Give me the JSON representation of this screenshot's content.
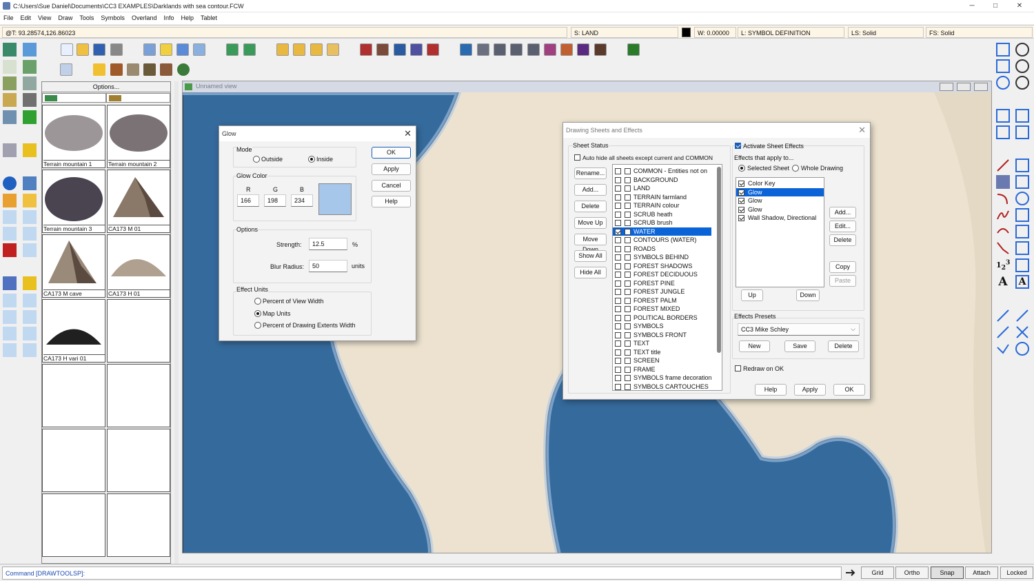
{
  "window": {
    "title": "C:\\Users\\Sue Daniel\\Documents\\CC3 EXAMPLES\\Darklands with sea contour.FCW",
    "min": "─",
    "max": "□",
    "close": "✕"
  },
  "menu": [
    "File",
    "Edit",
    "View",
    "Draw",
    "Tools",
    "Symbols",
    "Overland",
    "Info",
    "Help",
    "Tablet"
  ],
  "status": {
    "coords": "@T: 93.28574,126.86023",
    "sheet": "S: LAND",
    "width": "W: 0.00000",
    "layer": "L: SYMBOL DEFINITION",
    "line_style": "LS: Solid",
    "fill_style": "FS: Solid"
  },
  "symbols": {
    "options_label": "Options...",
    "items": [
      "Terrain mountain 1",
      "Terrain mountain 2",
      "Terrain mountain 3",
      "CA173 M 01",
      "CA173 M cave",
      "CA173 H 01",
      "CA173 H vari 01"
    ]
  },
  "map": {
    "title": "Unnamed view"
  },
  "glow": {
    "title": "Glow",
    "mode_label": "Mode",
    "outside": "Outside",
    "inside": "Inside",
    "color_label": "Glow Color",
    "r_label": "R",
    "g_label": "G",
    "b_label": "B",
    "r": "166",
    "g": "198",
    "b": "234",
    "swatch": "#a6c6ea",
    "options_label": "Options",
    "strength_label": "Strength:",
    "strength": "12.5",
    "strength_unit": "%",
    "blur_label": "Blur Radius:",
    "blur": "50",
    "blur_unit": "units",
    "units_label": "Effect Units",
    "u1": "Percent of View Width",
    "u2": "Map Units",
    "u3": "Percent of Drawing Extents Width",
    "ok": "OK",
    "apply": "Apply",
    "cancel": "Cancel",
    "help": "Help"
  },
  "sheets": {
    "title": "Drawing Sheets and Effects",
    "status_label": "Sheet Status",
    "auto_hide": "Auto hide all sheets except current and COMMON",
    "buttons": [
      "Rename...",
      "Add...",
      "Delete",
      "Move Up",
      "Move Down",
      "Show All",
      "Hide All"
    ],
    "list": [
      "COMMON - Entities not on",
      "BACKGROUND",
      "LAND",
      "TERRAIN farmland",
      "TERRAIN colour",
      "SCRUB heath",
      "SCRUB brush",
      "WATER",
      "CONTOURS (WATER)",
      "ROADS",
      "SYMBOLS BEHIND",
      "FOREST SHADOWS",
      "FOREST DECIDUOUS",
      "FOREST PINE",
      "FOREST JUNGLE",
      "FOREST PALM",
      "FOREST MIXED",
      "POLITICAL BORDERS",
      "SYMBOLS",
      "SYMBOLS FRONT",
      "TEXT",
      "TEXT title",
      "SCREEN",
      "FRAME",
      "SYMBOLS frame decoration",
      "SYMBOLS CARTOUCHES"
    ],
    "selected": "WATER",
    "activate": "Activate Sheet Effects",
    "applies_to": "Effects that apply to...",
    "selected_sheet": "Selected Sheet",
    "whole": "Whole Drawing",
    "effects": [
      "Color Key",
      "Glow",
      "Glow",
      "Glow",
      "Wall Shadow, Directional"
    ],
    "eff_buttons": {
      "add": "Add...",
      "edit": "Edit...",
      "delete": "Delete",
      "copy": "Copy",
      "paste": "Paste",
      "up": "Up",
      "down": "Down"
    },
    "presets_label": "Effects Presets",
    "preset": "CC3 Mike Schley",
    "new": "New",
    "save": "Save",
    "pdelete": "Delete",
    "redraw": "Redraw on OK",
    "help": "Help",
    "apply": "Apply",
    "ok": "OK"
  },
  "command": {
    "text": "Command [DRAWTOOLSP]:",
    "modes": [
      "Grid",
      "Ortho",
      "Snap",
      "Attach",
      "Locked"
    ]
  }
}
